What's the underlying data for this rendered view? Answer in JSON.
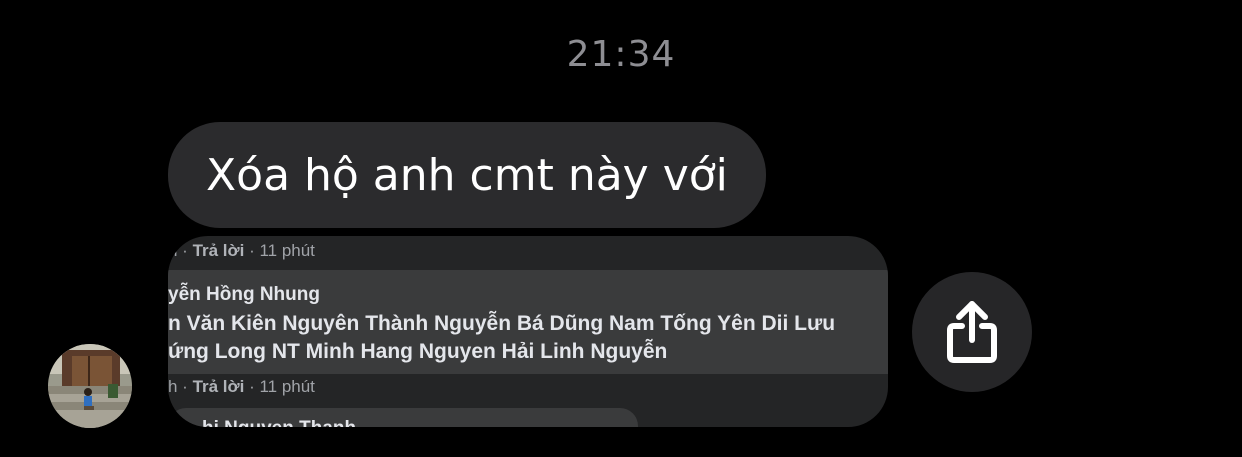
{
  "timestamp": "21:34",
  "message": {
    "text": "Xóa hộ anh cmt này với"
  },
  "screenshot": {
    "meta_top": {
      "prefix": "h · ",
      "reply": "Trả lời",
      "suffix": " · 11 phút"
    },
    "comment": {
      "author": "yễn Hồng Nhung",
      "line1": "n Văn Kiên Nguyên Thành Nguyễn Bá Dũng Nam Tống Yên Dii Lưu",
      "line2": "ứng Long NT Minh Hang Nguyen Hải Linh Nguyễn"
    },
    "meta_bottom": {
      "prefix": "h · ",
      "reply": "Trả lời",
      "suffix": " · 11 phút"
    },
    "next_author": "hi Nguyen Thanh"
  },
  "icons": {
    "share": "share-icon",
    "avatar": "avatar"
  },
  "colors": {
    "background": "#000000",
    "bubble": "#2b2b2d",
    "timestamp": "#8e8e93",
    "share_button": "#262628"
  }
}
